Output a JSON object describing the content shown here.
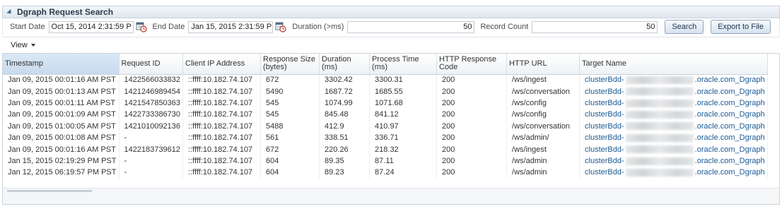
{
  "panel": {
    "title": "Dgraph Request Search"
  },
  "criteria": {
    "start_date_label": "Start Date",
    "start_date_value": "Oct 15, 2014 2:31:59 P",
    "end_date_label": "End Date",
    "end_date_value": "Jan 15, 2015 2:31:59 P",
    "duration_label": "Duration (>ms)",
    "duration_value": "50",
    "record_count_label": "Record Count",
    "record_count_value": "50",
    "search_label": "Search",
    "export_label": "Export to File"
  },
  "toolbar": {
    "view_label": "View"
  },
  "table": {
    "columns": [
      {
        "label": "Timestamp"
      },
      {
        "label": "Request ID"
      },
      {
        "label": "Client IP Address"
      },
      {
        "label": "Response Size (bytes)"
      },
      {
        "label": "Duration (ms)"
      },
      {
        "label": "Process Time (ms)"
      },
      {
        "label": "HTTP Response Code"
      },
      {
        "label": "HTTP URL"
      },
      {
        "label": "Target Name"
      }
    ],
    "rows": [
      {
        "timestamp": "Jan 09, 2015 00:01:16 AM PST",
        "request_id": "1422566033832",
        "client_ip": "::ffff:10.182.74.107",
        "response_size": "672",
        "duration": "3302.42",
        "process_time": "3300.31",
        "http_code": "200",
        "http_url": "/ws/ingest",
        "target_prefix": "clusterBdd-",
        "target_suffix": ".oracle.com_Dgraph"
      },
      {
        "timestamp": "Jan 09, 2015 00:01:13 AM PST",
        "request_id": "1421246989454",
        "client_ip": "::ffff:10.182.74.107",
        "response_size": "5490",
        "duration": "1687.72",
        "process_time": "1685.55",
        "http_code": "200",
        "http_url": "/ws/conversation",
        "target_prefix": "clusterBdd-",
        "target_suffix": ".oracle.com_Dgraph"
      },
      {
        "timestamp": "Jan 09, 2015 00:01:11 AM PST",
        "request_id": "1421547850363",
        "client_ip": "::ffff:10.182.74.107",
        "response_size": "545",
        "duration": "1074.99",
        "process_time": "1071.68",
        "http_code": "200",
        "http_url": "/ws/config",
        "target_prefix": "clusterBdd-",
        "target_suffix": ".oracle.com_Dgraph"
      },
      {
        "timestamp": "Jan 09, 2015 00:01:09 AM PST",
        "request_id": "1422733386730",
        "client_ip": "::ffff:10.182.74.107",
        "response_size": "545",
        "duration": "845.48",
        "process_time": "841.12",
        "http_code": "200",
        "http_url": "/ws/config",
        "target_prefix": "clusterBdd-",
        "target_suffix": ".oracle.com_Dgraph"
      },
      {
        "timestamp": "Jan 09, 2015 01:00:05 AM PST",
        "request_id": "1421010092136",
        "client_ip": "::ffff:10.182.74.107",
        "response_size": "5488",
        "duration": "412.9",
        "process_time": "410.97",
        "http_code": "200",
        "http_url": "/ws/conversation",
        "target_prefix": "clusterBdd-",
        "target_suffix": ".oracle.com_Dgraph"
      },
      {
        "timestamp": "Jan 09, 2015 00:01:08 AM PST",
        "request_id": "-",
        "client_ip": "::ffff:10.182.74.107",
        "response_size": "561",
        "duration": "338.51",
        "process_time": "336.71",
        "http_code": "200",
        "http_url": "/ws/admin/",
        "target_prefix": "clusterBdd-",
        "target_suffix": ".oracle.com_Dgraph"
      },
      {
        "timestamp": "Jan 09, 2015 00:01:16 AM PST",
        "request_id": "1422183739612",
        "client_ip": "::ffff:10.182.74.107",
        "response_size": "672",
        "duration": "220.26",
        "process_time": "218.32",
        "http_code": "200",
        "http_url": "/ws/ingest",
        "target_prefix": "clusterBdd-",
        "target_suffix": ".oracle.com_Dgraph"
      },
      {
        "timestamp": "Jan 15, 2015 02:19:29 PM PST",
        "request_id": "-",
        "client_ip": "::ffff:10.182.74.107",
        "response_size": "604",
        "duration": "89.35",
        "process_time": "87.11",
        "http_code": "200",
        "http_url": "/ws/admin",
        "target_prefix": "clusterBdd-",
        "target_suffix": ".oracle.com_Dgraph"
      },
      {
        "timestamp": "Jan 12, 2015 06:19:57 PM PST",
        "request_id": "-",
        "client_ip": "::ffff:10.182.74.107",
        "response_size": "604",
        "duration": "89.23",
        "process_time": "87.24",
        "http_code": "200",
        "http_url": "/ws/admin",
        "target_prefix": "clusterBdd-",
        "target_suffix": ".oracle.com_Dgraph"
      }
    ]
  },
  "colors": {
    "accent": "#1a5a96",
    "header_bg": "#dfe7ee",
    "sorted_header_bg": "#c7daee",
    "button_border": "#8fa7bd"
  },
  "icons": {
    "calendar": "calendar-clock-icon",
    "collapse": "collapse-triangle-icon",
    "view_menu": "chevron-down-icon"
  }
}
